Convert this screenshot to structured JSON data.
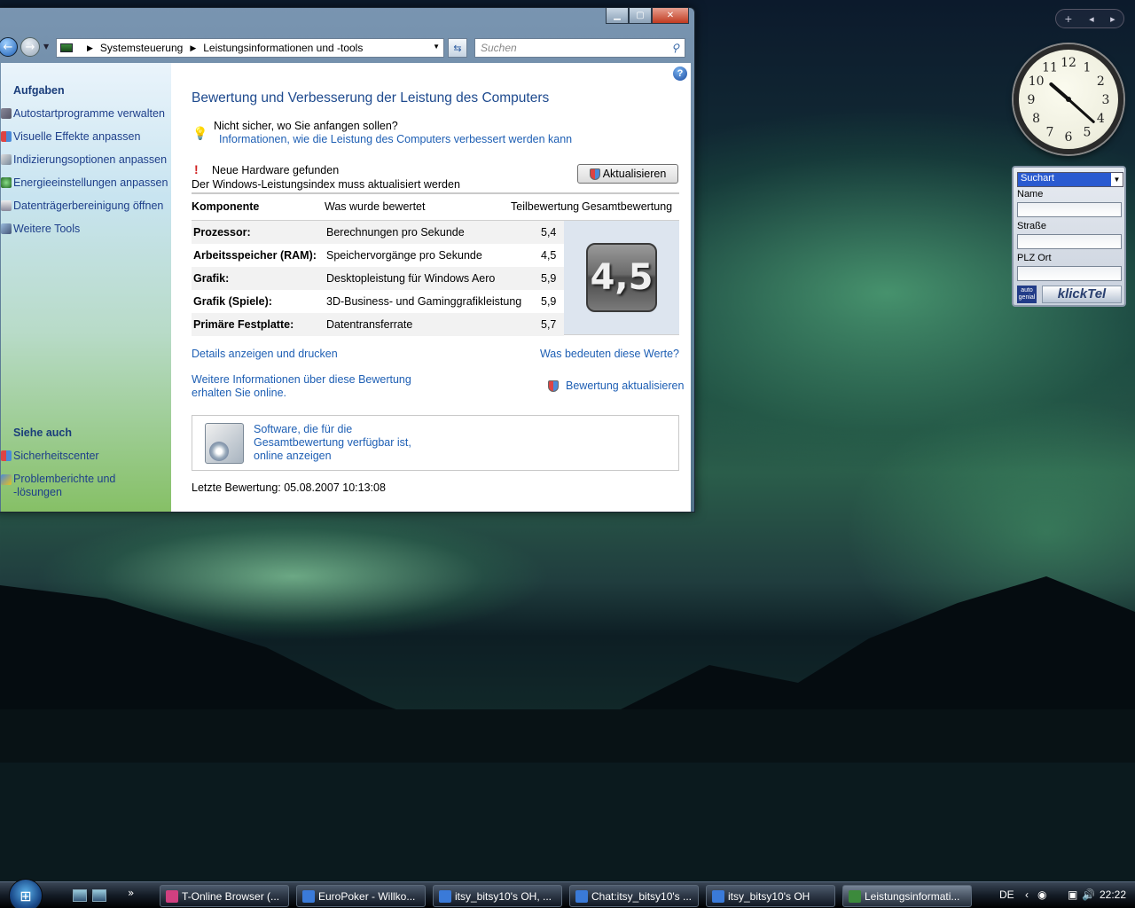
{
  "window": {
    "address": {
      "crumbs": [
        "Systemsteuerung",
        "Leistungsinformationen und -tools"
      ]
    },
    "search_placeholder": "Suchen"
  },
  "sidebar": {
    "tasks_heading": "Aufgaben",
    "tasks": [
      {
        "label": "Autostartprogramme verwalten",
        "icon": "startup-programs-icon"
      },
      {
        "label": "Visuelle Effekte anpassen",
        "icon": "shield-icon"
      },
      {
        "label": "Indizierungsoptionen anpassen",
        "icon": "indexing-icon"
      },
      {
        "label": "Energieeinstellungen anpassen",
        "icon": "power-icon"
      },
      {
        "label": "Datenträgerbereinigung öffnen",
        "icon": "disk-cleanup-icon"
      },
      {
        "label": "Weitere Tools",
        "icon": "tools-icon"
      }
    ],
    "see_also_heading": "Siehe auch",
    "see_also": [
      {
        "label": "Sicherheitscenter",
        "icon": "security-center-icon"
      },
      {
        "label_line1": "Problemberichte und",
        "label_line2": "-lösungen",
        "icon": "problem-reports-icon"
      }
    ]
  },
  "main": {
    "title": "Bewertung und Verbesserung der Leistung des Computers",
    "tip_text": "Nicht sicher, wo Sie anfangen sollen?",
    "tip_link": "Informationen, wie die Leistung des Computers verbessert werden kann",
    "warning_title": "Neue Hardware gefunden",
    "warning_text": "Der Windows-Leistungsindex muss aktualisiert werden",
    "update_button": "Aktualisieren",
    "table": {
      "headers": [
        "Komponente",
        "Was wurde bewertet",
        "Teilbewertung",
        "Gesamtbewertung"
      ],
      "rows": [
        {
          "component": "Prozessor:",
          "what": "Berechnungen pro Sekunde",
          "score": "5,4"
        },
        {
          "component": "Arbeitsspeicher (RAM):",
          "what": "Speichervorgänge pro Sekunde",
          "score": "4,5"
        },
        {
          "component": "Grafik:",
          "what": "Desktopleistung für Windows Aero",
          "score": "5,9"
        },
        {
          "component": "Grafik (Spiele):",
          "what": "3D-Business- und Gaminggrafikleistung",
          "score": "5,9"
        },
        {
          "component": "Primäre Festplatte:",
          "what": "Datentransferrate",
          "score": "5,7"
        }
      ],
      "total_score": "4,5"
    },
    "links": {
      "details": "Details anzeigen und drucken",
      "meaning": "Was bedeuten diese Werte?",
      "more_info_line1": "Weitere Informationen über diese Bewertung",
      "more_info_line2": "erhalten Sie online.",
      "reevaluate": "Bewertung aktualisieren"
    },
    "software_line1": "Software, die für die",
    "software_line2": "Gesamtbewertung verfügbar ist,",
    "software_line3": "online anzeigen",
    "last_evaluation": "Letzte Bewertung: 05.08.2007 10:13:08"
  },
  "gadgets": {
    "clock_numbers": [
      "12",
      "1",
      "2",
      "3",
      "4",
      "5",
      "6",
      "7",
      "8",
      "9",
      "10",
      "11"
    ],
    "klicktel": {
      "search_type": "Suchart",
      "name_label": "Name",
      "street_label": "Straße",
      "zip_label": "PLZ Ort",
      "logo_text_line1": "auto",
      "logo_text_line2": "genial",
      "brand": "klickTel"
    }
  },
  "taskbar": {
    "tasks": [
      {
        "label": "T-Online Browser (...",
        "icon": "t-online-icon",
        "color": "#d04080"
      },
      {
        "label": "EuroPoker - Willko...",
        "icon": "star-icon",
        "color": "#3a7ad8"
      },
      {
        "label": "itsy_bitsy10's OH, ...",
        "icon": "star-icon",
        "color": "#3a7ad8"
      },
      {
        "label": "Chat:itsy_bitsy10's ...",
        "icon": "star-icon",
        "color": "#3a7ad8"
      },
      {
        "label": "itsy_bitsy10's OH",
        "icon": "star-icon",
        "color": "#3a7ad8"
      },
      {
        "label": "Leistungsinformati...",
        "icon": "control-panel-icon",
        "color": "#3c8a3c",
        "active": true
      }
    ],
    "language": "DE",
    "time": "22:22"
  }
}
